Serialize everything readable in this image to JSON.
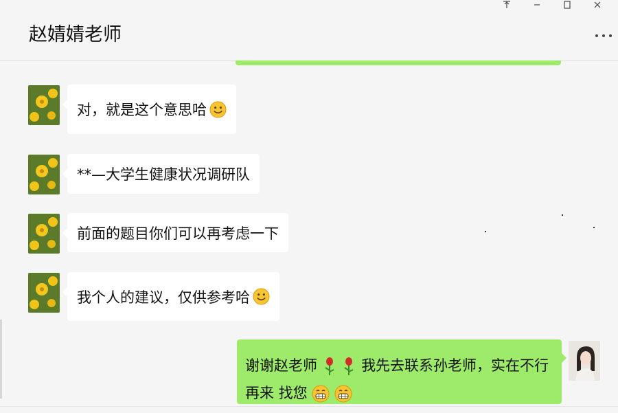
{
  "window": {
    "title": "赵婧婧老师",
    "controls": [
      "pin-icon",
      "minimize-icon",
      "maximize-icon",
      "close-icon"
    ]
  },
  "more_label": "…",
  "messages": [
    {
      "sender": "other",
      "text": "对，就是这个意思哈",
      "emoji": "smile-emoji"
    },
    {
      "sender": "other",
      "text": "**—大学生健康状况调研队"
    },
    {
      "sender": "other",
      "text": "前面的题目你们可以再考虑一下"
    },
    {
      "sender": "other",
      "text": "我个人的建议，仅供参考哈",
      "emoji": "smile-emoji"
    },
    {
      "sender": "self",
      "part1": "谢谢赵老师",
      "part2": "我先去联系孙老师，实在不行再来",
      "part3": "找您",
      "emojis": [
        "rose-emoji",
        "rose-emoji",
        "grin-emoji",
        "grin-emoji"
      ]
    }
  ],
  "colors": {
    "bubble_self": "#9eea6a",
    "bubble_other": "#ffffff",
    "background": "#f5f5f5"
  }
}
